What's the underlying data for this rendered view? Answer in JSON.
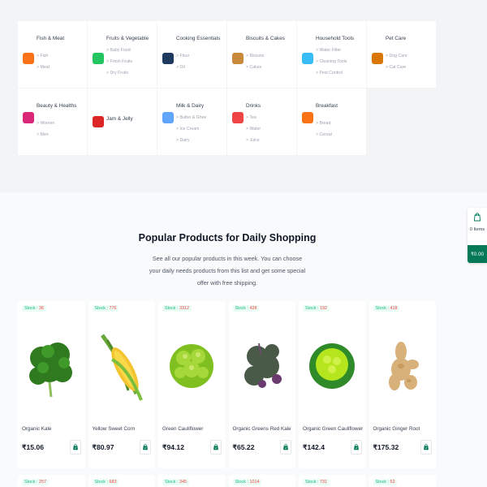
{
  "categories": [
    {
      "title": "Fish & Meat",
      "icon": "fish-meat-icon",
      "color": "#f97316",
      "subs": [
        "Fish",
        "Meat"
      ]
    },
    {
      "title": "Fruits & Vegetable",
      "icon": "cabbage-icon",
      "color": "#22c55e",
      "subs": [
        "Baby Food",
        "Fresh Fruits",
        "Dry Fruits"
      ]
    },
    {
      "title": "Cooking Essentials",
      "icon": "cooking-pot-icon",
      "color": "#1e3a5f",
      "subs": [
        "Flour",
        "Oil"
      ]
    },
    {
      "title": "Biscuits & Cakes",
      "icon": "cookie-icon",
      "color": "#c98a3c",
      "subs": [
        "Biscuits",
        "Cakes"
      ]
    },
    {
      "title": "Household Tools",
      "icon": "spray-bottle-icon",
      "color": "#38bdf8",
      "subs": [
        "Water Filter",
        "Cleaning Tools",
        "Pest Control"
      ]
    },
    {
      "title": "Pet Care",
      "icon": "cat-icon",
      "color": "#d97706",
      "subs": [
        "Dog Care",
        "Cat Care"
      ]
    },
    {
      "title": "Beauty & Healths",
      "icon": "beauty-icon",
      "color": "#db2777",
      "subs": [
        "Women",
        "Men"
      ]
    },
    {
      "title": "Jam & Jelly",
      "icon": "jam-jar-icon",
      "color": "#dc2626",
      "subs": []
    },
    {
      "title": "Milk & Dairy",
      "icon": "milk-bottle-icon",
      "color": "#60a5fa",
      "subs": [
        "Butter & Ghee",
        "Ice Cream",
        "Dairy"
      ]
    },
    {
      "title": "Drinks",
      "icon": "drink-icon",
      "color": "#ef4444",
      "subs": [
        "Tea",
        "Water",
        "Juice"
      ]
    },
    {
      "title": "Breakfast",
      "icon": "donut-icon",
      "color": "#f97316",
      "subs": [
        "Bread",
        "Cereal"
      ]
    }
  ],
  "section": {
    "title": "Popular Products for Daily Shopping",
    "description": "See all our popular products in this week. You can choose your daily needs products from this list and get some special offer with free shipping."
  },
  "stock_label": "Stock :",
  "products": [
    {
      "stock": "36",
      "name": "Organic Kale",
      "price": "₹15.06",
      "image": "kale"
    },
    {
      "stock": "776",
      "name": "Yellow Sweet Corn",
      "price": "₹80.97",
      "image": "corn"
    },
    {
      "stock": "3312",
      "name": "Green Cauliflower",
      "price": "₹94.12",
      "image": "romanesco"
    },
    {
      "stock": "428",
      "name": "Organic Greens Red Kale",
      "price": "₹65.22",
      "image": "red-kale"
    },
    {
      "stock": "192",
      "name": "Organic Green Cauliflower",
      "price": "₹142.4",
      "image": "green-cauliflower"
    },
    {
      "stock": "418",
      "name": "Organic Ginger Root",
      "price": "₹175.32",
      "image": "ginger"
    }
  ],
  "products_row2": [
    {
      "stock": "257"
    },
    {
      "stock": "683"
    },
    {
      "stock": "345"
    },
    {
      "stock": "1014"
    },
    {
      "stock": "731"
    },
    {
      "stock": "53"
    }
  ],
  "cart": {
    "items": "0 Items",
    "total": "₹0.00"
  }
}
